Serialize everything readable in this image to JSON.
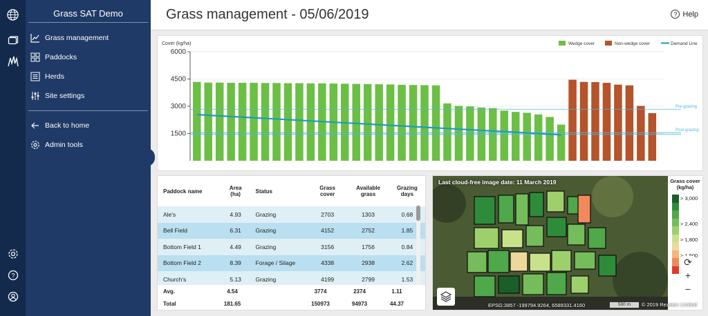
{
  "app": {
    "title": "Grass SAT Demo"
  },
  "header": {
    "title": "Grass management - 05/06/2019",
    "help": "Help"
  },
  "nav": {
    "items": [
      {
        "label": "Grass management",
        "icon": "chart-icon"
      },
      {
        "label": "Paddocks",
        "icon": "grid-icon"
      },
      {
        "label": "Herds",
        "icon": "list-icon"
      },
      {
        "label": "Site settings",
        "icon": "sliders-icon"
      }
    ],
    "back": "Back to home",
    "admin": "Admin tools"
  },
  "chart_data": {
    "type": "bar",
    "ylabel": "Cover (kg/ha)",
    "ylim": [
      0,
      6000
    ],
    "yticks": [
      1500,
      3000,
      4500,
      6000
    ],
    "legend": [
      "Wedge cover",
      "Non-wedge cover",
      "Demand Line"
    ],
    "legend_position": "top-right",
    "colors": {
      "wedge": "#6cbf45",
      "nonwedge": "#b5532a",
      "demand": "#1e9ac4",
      "ref": "#4fb8d8"
    },
    "series": [
      {
        "name": "Wedge cover",
        "values": [
          4340,
          4300,
          4300,
          4290,
          4290,
          4290,
          4280,
          4280,
          4270,
          4270,
          4260,
          4260,
          4250,
          4240,
          4230,
          4220,
          4210,
          4200,
          4180,
          4170,
          4160,
          4150,
          3160,
          3020,
          2990,
          2930,
          2900,
          2760,
          2690,
          2640,
          2550,
          2410,
          1990
        ]
      },
      {
        "name": "Non-wedge cover",
        "values": [
          4460,
          4340,
          4330,
          4290,
          4190,
          4150,
          3020,
          2620
        ]
      }
    ],
    "demand_line": {
      "start": 2540,
      "end": 1430
    },
    "reference_lines": [
      {
        "name": "Pre-grazing",
        "value": 2840
      },
      {
        "name": "Post-grazing",
        "value": 1550
      },
      {
        "name": "",
        "value": 1450
      }
    ]
  },
  "table": {
    "headers": [
      [
        "Paddock name",
        ""
      ],
      [
        "Area",
        "(ha)"
      ],
      [
        "Status",
        ""
      ],
      [
        "Grass",
        "cover"
      ],
      [
        "Available",
        "grass"
      ],
      [
        "Grazing",
        "days"
      ]
    ],
    "rows": [
      [
        "Ale's",
        "4.93",
        "Grazing",
        "2703",
        "1303",
        "0.68"
      ],
      [
        "Bell Field",
        "6.31",
        "Grazing",
        "4152",
        "2752",
        "1.85"
      ],
      [
        "Bottom Field 1",
        "4.49",
        "Grazing",
        "3156",
        "1756",
        "0.84"
      ],
      [
        "Bottom Field 2",
        "8.39",
        "Forage / Silage",
        "4338",
        "2938",
        "2.62"
      ],
      [
        "Church's",
        "5.13",
        "Grazing",
        "4199",
        "2799",
        "1.53"
      ]
    ],
    "avg": [
      "Avg.",
      "4.54",
      "",
      "3774",
      "2374",
      "1.11"
    ],
    "total": [
      "Total",
      "181.65",
      "",
      "150973",
      "94973",
      "44.37"
    ]
  },
  "map": {
    "label": "Last cloud-free image date: 11 March 2019",
    "legend_title": "Grass cover (kg/ha)",
    "legend": [
      "> 3,000",
      "> 2,400",
      "> 1,800",
      "> 1,500"
    ],
    "legend_colors": [
      "#1a5e2a",
      "#2e8b3a",
      "#4fa84a",
      "#74bd5a",
      "#9dd06c",
      "#c8e28a",
      "#ecd99a",
      "#f4b67a",
      "#f08a5c",
      "#e23a2a"
    ],
    "coords": "EPSG:3857 -199794.9264, 6589331.4160",
    "scale": "500 m",
    "copyright": "© 2019 Rezatec Limited"
  }
}
